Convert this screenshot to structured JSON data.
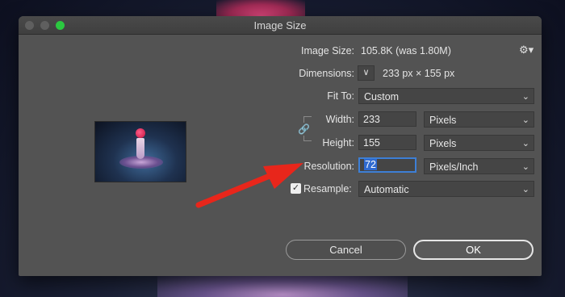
{
  "window": {
    "title": "Image Size"
  },
  "image_size": {
    "label": "Image Size:",
    "value": "105.8K (was 1.80M)"
  },
  "dimensions": {
    "label": "Dimensions:",
    "value": "233 px  ×  155 px"
  },
  "fit_to": {
    "label": "Fit To:",
    "value": "Custom"
  },
  "width": {
    "label": "Width:",
    "value": "233",
    "unit": "Pixels"
  },
  "height": {
    "label": "Height:",
    "value": "155",
    "unit": "Pixels"
  },
  "resolution": {
    "label": "Resolution:",
    "value": "72",
    "unit": "Pixels/Inch"
  },
  "resample": {
    "label": "Resample:",
    "value": "Automatic",
    "checked": true
  },
  "buttons": {
    "cancel": "Cancel",
    "ok": "OK"
  },
  "colors": {
    "annotation_arrow": "#e8261b",
    "focus": "#3d7fd6",
    "traffic_zoom": "#2bc840"
  }
}
